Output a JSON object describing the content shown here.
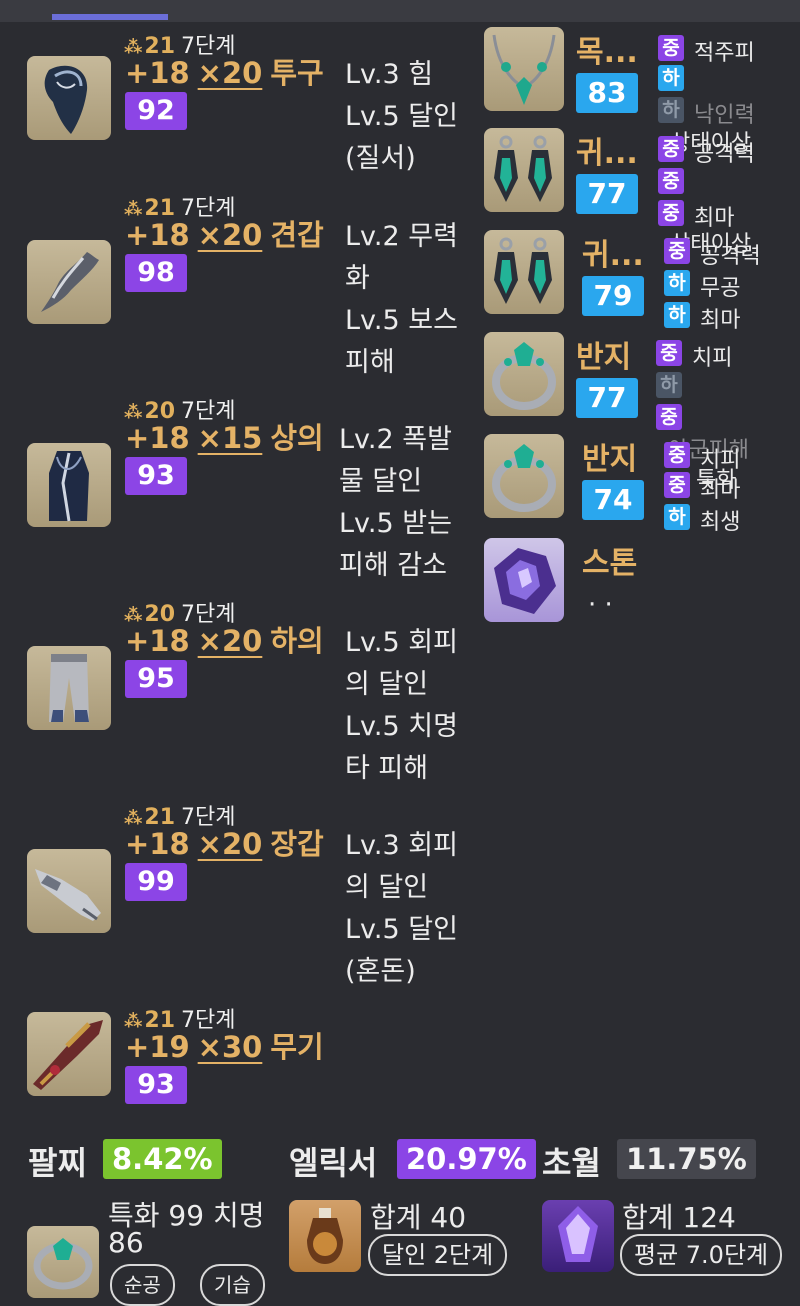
{
  "equipment": [
    {
      "quality_num": "21",
      "stage": "7단계",
      "enhance": "+18",
      "mult": "×20",
      "name": "투구",
      "score": "92",
      "skills": [
        "Lv.3 힘",
        "Lv.5 달인",
        "(질서)"
      ],
      "icon": "helmet-icon"
    },
    {
      "quality_num": "21",
      "stage": "7단계",
      "enhance": "+18",
      "mult": "×20",
      "name": "견갑",
      "score": "98",
      "skills": [
        "Lv.2 무력",
        "화",
        "Lv.5 보스",
        "피해"
      ],
      "icon": "shoulder-icon"
    },
    {
      "quality_num": "20",
      "stage": "7단계",
      "enhance": "+18",
      "mult": "×15",
      "name": "상의",
      "score": "93",
      "skills": [
        "Lv.2 폭발",
        "물 달인",
        "Lv.5 받는",
        "피해 감소"
      ],
      "icon": "chest-icon"
    },
    {
      "quality_num": "20",
      "stage": "7단계",
      "enhance": "+18",
      "mult": "×20",
      "name": "하의",
      "score": "95",
      "skills": [
        "Lv.5 회피",
        "의 달인",
        "Lv.5 치명",
        "타 피해"
      ],
      "icon": "pants-icon"
    },
    {
      "quality_num": "21",
      "stage": "7단계",
      "enhance": "+18",
      "mult": "×20",
      "name": "장갑",
      "score": "99",
      "skills": [
        "Lv.3 회피",
        "의 달인",
        "Lv.5 달인",
        "(혼돈)"
      ],
      "icon": "gloves-icon"
    },
    {
      "quality_num": "21",
      "stage": "7단계",
      "enhance": "+19",
      "mult": "×30",
      "name": "무기",
      "score": "93",
      "skills": [],
      "icon": "weapon-icon"
    }
  ],
  "accessories": [
    {
      "name": "목...",
      "quality": "83",
      "icon": "necklace-icon",
      "tags": [
        {
          "t": "중",
          "c": "mid"
        },
        {
          "t": "하",
          "c": "low"
        },
        {
          "t": "하",
          "c": "dim"
        }
      ],
      "opts": [
        {
          "t": "적주피",
          "dim": false
        },
        {
          "t": "낙인력",
          "dim": true
        },
        {
          "t": "상태이상",
          "dim": false
        }
      ]
    },
    {
      "name": "귀...",
      "quality": "77",
      "icon": "earring-icon",
      "tags": [
        {
          "t": "중",
          "c": "mid"
        },
        {
          "t": "중",
          "c": "mid"
        },
        {
          "t": "중",
          "c": "mid"
        }
      ],
      "opts": [
        {
          "t": "공격력",
          "dim": false
        },
        {
          "t": "최마",
          "dim": false
        },
        {
          "t": "상태이상",
          "dim": false
        }
      ]
    },
    {
      "name": "귀...",
      "quality": "79",
      "icon": "earring-icon",
      "tags": [
        {
          "t": "중",
          "c": "mid"
        },
        {
          "t": "하",
          "c": "low"
        },
        {
          "t": "하",
          "c": "low"
        }
      ],
      "opts": [
        {
          "t": "공격력",
          "dim": false
        },
        {
          "t": "무공",
          "dim": false
        },
        {
          "t": "최마",
          "dim": false
        }
      ]
    },
    {
      "name": "반지",
      "quality": "77",
      "icon": "ring-icon",
      "tags": [
        {
          "t": "중",
          "c": "mid"
        },
        {
          "t": "하",
          "c": "dim"
        },
        {
          "t": "중",
          "c": "mid"
        }
      ],
      "opts": [
        {
          "t": "치피",
          "dim": false
        },
        {
          "t": "아군피해",
          "dim": true
        },
        {
          "t": "특화",
          "dim": false
        }
      ]
    },
    {
      "name": "반지",
      "quality": "74",
      "icon": "ring-icon",
      "tags": [
        {
          "t": "중",
          "c": "mid"
        },
        {
          "t": "중",
          "c": "mid"
        },
        {
          "t": "하",
          "c": "low"
        }
      ],
      "opts": [
        {
          "t": "치피",
          "dim": false
        },
        {
          "t": "최마",
          "dim": false
        },
        {
          "t": "최생",
          "dim": false
        }
      ]
    }
  ],
  "stone": {
    "name": "스톤",
    "dots": "· ·",
    "icon": "stone-icon"
  },
  "stats": {
    "bracelet_label": "팔찌",
    "bracelet_value": "8.42%",
    "elixir_label": "엘릭서",
    "elixir_value": "20.97%",
    "transcend_label": "초월",
    "transcend_value": "11.75%"
  },
  "bottom": {
    "bracelet_stats_1": "특화 99 치명",
    "bracelet_stats_2": "86",
    "bracelet_chip_1": "순공",
    "bracelet_chip_2": "기습",
    "elixir_total": "합계 40",
    "elixir_level": "달인 2단계",
    "transcend_total": "합계 124",
    "transcend_avg": "평균 7.0단계"
  }
}
